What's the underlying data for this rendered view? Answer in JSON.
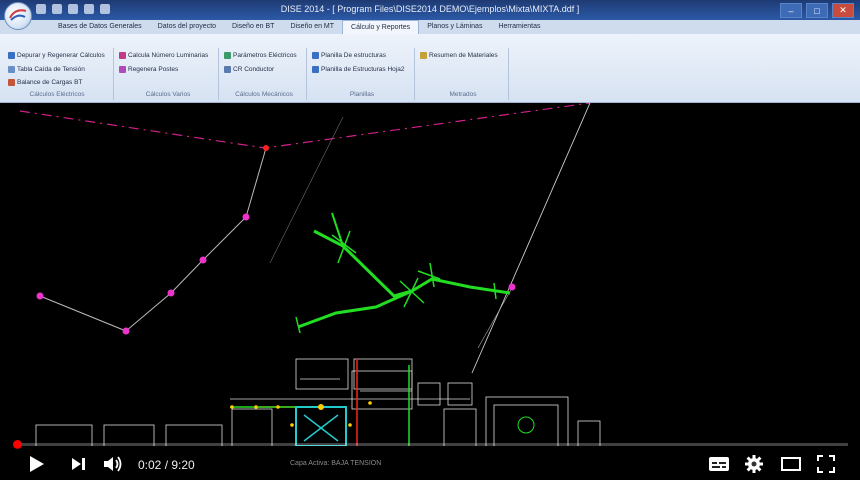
{
  "window": {
    "title": "DISE 2014 - [ Program Files\\DISE2014 DEMO\\Ejemplos\\Mixta\\MIXTA.ddf ]"
  },
  "tabs": [
    {
      "label": "Bases de Datos Generales"
    },
    {
      "label": "Datos del proyecto"
    },
    {
      "label": "Diseño en BT"
    },
    {
      "label": "Diseño en MT"
    },
    {
      "label": "Cálculo y Reportes"
    },
    {
      "label": "Planos y Láminas"
    },
    {
      "label": "Herramientas"
    }
  ],
  "ribbon": {
    "calculos_electricos": {
      "items": [
        "Depurar y Regenerar Cálculos",
        "Tabla Caída de Tensión",
        "Balance de Cargas BT"
      ],
      "label": "Cálculos Eléctricos"
    },
    "calculos_varios": {
      "items": [
        "Calcula Número Luminarias",
        "Regenera Postes"
      ],
      "label": "Cálculos Varios"
    },
    "calculos_mecanicos": {
      "items": [
        "Parámetros Eléctricos",
        "CR Conductor"
      ],
      "label": "Cálculos Mecánicos"
    },
    "planillas": {
      "items": [
        "Planilla De estructuras",
        "Planilla de Estructuras Hoja2"
      ],
      "label": "Planillas"
    },
    "metrados": {
      "items": [
        "Resumen de Materiales"
      ],
      "label": "Metrados"
    }
  },
  "status_bar": {
    "active_layer": "Capa Activa: BAJA TENSION"
  },
  "player": {
    "current_time": "0:02",
    "duration": "9:20",
    "time_display": "0:02 / 9:20",
    "progress_fraction": 0.004
  },
  "colors": {
    "accent": "#ff0000",
    "cad_green": "#22dd22",
    "cad_magenta": "#ee33cc"
  },
  "icons": [
    "play-icon",
    "next-icon",
    "volume-icon",
    "captions-icon",
    "settings-icon",
    "theater-icon",
    "fullscreen-icon"
  ]
}
